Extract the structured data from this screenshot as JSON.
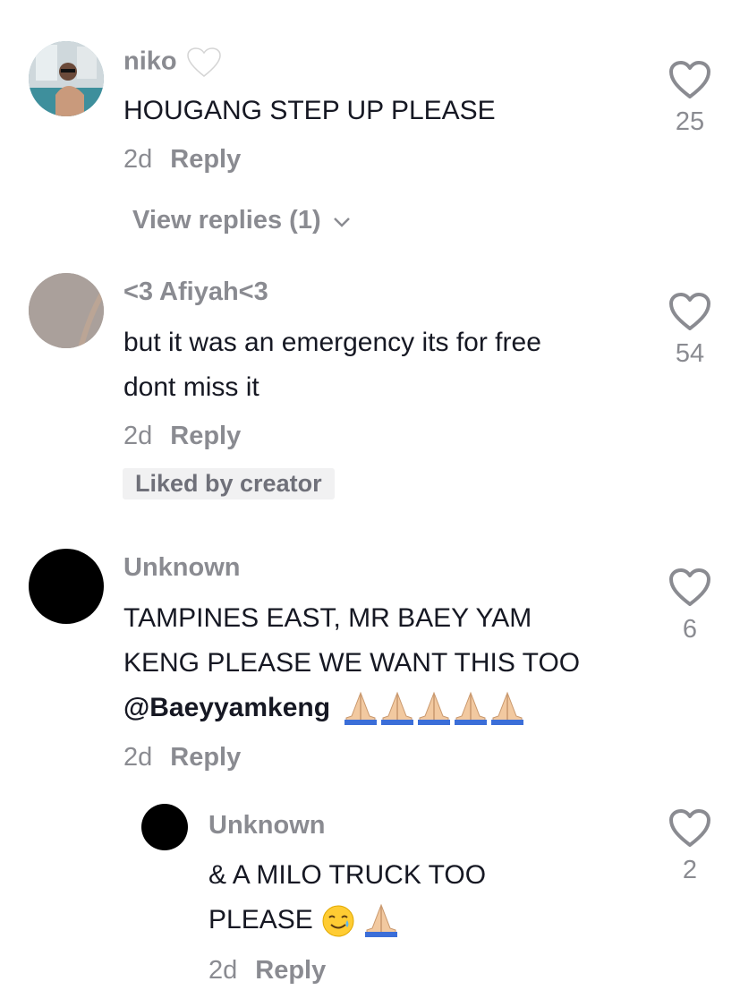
{
  "comments": [
    {
      "username": "niko",
      "username_emoji": "white-heart-emoji",
      "text": "HOUGANG STEP UP PLEASE",
      "age": "2d",
      "reply_label": "Reply",
      "likes": "25",
      "view_replies": "View replies (1)"
    },
    {
      "username": "<3 Afiyah<3",
      "text_line1": "but it was an emergency its for free",
      "text_line2": "dont miss it",
      "age": "2d",
      "reply_label": "Reply",
      "likes": "54",
      "badge": "Liked by creator"
    },
    {
      "username": "Unknown",
      "text_line1": "TAMPINES EAST, MR BAEY YAM",
      "text_line2": "KENG PLEASE WE WANT THIS TOO",
      "mention": "@Baeyyamkeng",
      "trailing_emoji": "folded-hands x5",
      "age": "2d",
      "reply_label": "Reply",
      "likes": "6"
    },
    {
      "username": "Unknown",
      "text_line1": "& A MILO TRUCK TOO",
      "text_line2": "PLEASE",
      "trailing_emoji": "smiling-face-with-tear, folded-hands",
      "age": "2d",
      "reply_label": "Reply",
      "likes": "2"
    }
  ],
  "colors": {
    "text": "#161823",
    "muted": "#8a8b91",
    "badge_bg": "#f1f1f2"
  }
}
